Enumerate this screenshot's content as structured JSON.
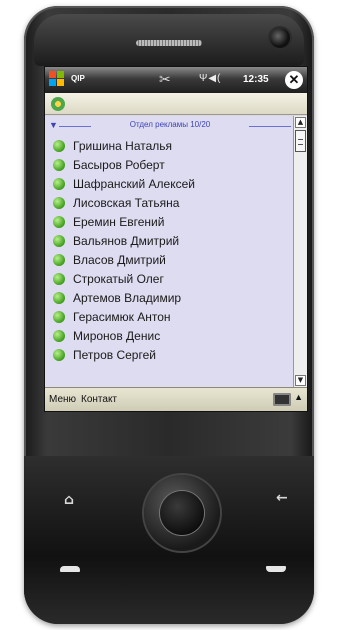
{
  "status_bar": {
    "app_title": "QIP",
    "clock": "12:35",
    "signal_icon": "signal-icon",
    "volume_icon": "volume-icon",
    "close_label": "✕"
  },
  "contact_list": {
    "group_label": "Отдел рекламы 10/20",
    "contacts": [
      {
        "name": "Гришина Наталья"
      },
      {
        "name": "Басыров Роберт"
      },
      {
        "name": "Шафранский Алексей"
      },
      {
        "name": "Лисовская Татьяна"
      },
      {
        "name": "Еремин Евгений"
      },
      {
        "name": "Вальянов Дмитрий"
      },
      {
        "name": "Власов Дмитрий"
      },
      {
        "name": "Строкатый Олег"
      },
      {
        "name": "Артемов Владимир"
      },
      {
        "name": "Герасимюк Антон"
      },
      {
        "name": "Миронов Денис"
      },
      {
        "name": "Петров Сергей"
      }
    ]
  },
  "softkeys": {
    "left": "Меню",
    "right": "Контакт"
  },
  "colors": {
    "online_status": "#3f9d1c",
    "group_header": "#3e44b8",
    "list_background": "#dedcf0"
  }
}
